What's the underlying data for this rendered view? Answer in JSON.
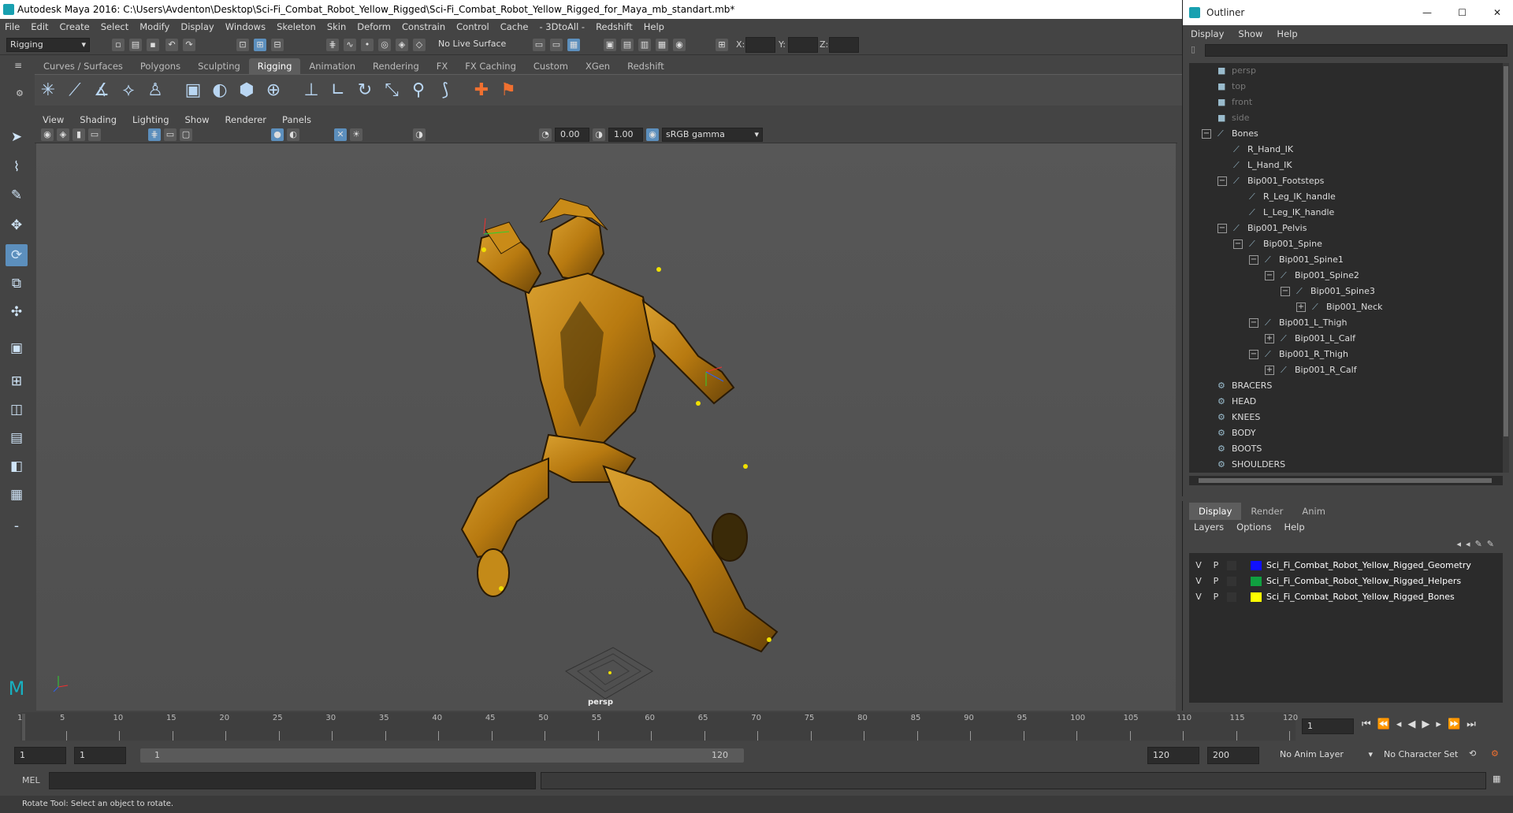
{
  "window": {
    "title": "Autodesk Maya 2016: C:\\Users\\Avdenton\\Desktop\\Sci-Fi_Combat_Robot_Yellow_Rigged\\Sci-Fi_Combat_Robot_Yellow_Rigged_for_Maya_mb_standart.mb*"
  },
  "menus": [
    "File",
    "Edit",
    "Create",
    "Select",
    "Modify",
    "Display",
    "Windows",
    "Skeleton",
    "Skin",
    "Deform",
    "Constrain",
    "Control",
    "Cache",
    "- 3DtoAll -",
    "Redshift",
    "Help"
  ],
  "toolbar": {
    "mode": "Rigging",
    "live_surface": "No Live Surface",
    "x_label": "X:",
    "y_label": "Y:",
    "z_label": "Z:"
  },
  "shelf_tabs": [
    "Curves / Surfaces",
    "Polygons",
    "Sculpting",
    "Rigging",
    "Animation",
    "Rendering",
    "FX",
    "FX Caching",
    "Custom",
    "XGen",
    "Redshift"
  ],
  "active_shelf": "Rigging",
  "viewport": {
    "menus": [
      "View",
      "Shading",
      "Lighting",
      "Show",
      "Renderer",
      "Panels"
    ],
    "near": "0.00",
    "far": "1.00",
    "color_space": "sRGB gamma",
    "camera_label": "persp"
  },
  "timeline": {
    "ticks": [
      "1",
      "5",
      "10",
      "15",
      "20",
      "25",
      "30",
      "35",
      "40",
      "45",
      "50",
      "55",
      "60",
      "65",
      "70",
      "75",
      "80",
      "85",
      "90",
      "95",
      "100",
      "105",
      "110",
      "115",
      "120"
    ],
    "current_frame": "1"
  },
  "range": {
    "start": "1",
    "start_inner": "1",
    "slider_start": "1",
    "slider_end": "120",
    "end_inner": "120",
    "end": "200",
    "anim_layer": "No Anim Layer",
    "character_set": "No Character Set"
  },
  "command": {
    "lang": "MEL"
  },
  "status": {
    "text": "Rotate Tool: Select an object to rotate."
  },
  "outliner": {
    "title": "Outliner",
    "menus": [
      "Display",
      "Show",
      "Help"
    ],
    "items": [
      {
        "label": "persp",
        "icon": "camera-icon",
        "indent": 2,
        "dim": true
      },
      {
        "label": "top",
        "icon": "camera-icon",
        "indent": 2,
        "dim": true
      },
      {
        "label": "front",
        "icon": "camera-icon",
        "indent": 2,
        "dim": true
      },
      {
        "label": "side",
        "icon": "camera-icon",
        "indent": 2,
        "dim": true
      },
      {
        "label": "Bones",
        "icon": "joint-icon",
        "indent": 2,
        "exp": "−"
      },
      {
        "label": "R_Hand_IK",
        "icon": "joint-icon",
        "indent": 3
      },
      {
        "label": "L_Hand_IK",
        "icon": "joint-icon",
        "indent": 3
      },
      {
        "label": "Bip001_Footsteps",
        "icon": "joint-icon",
        "indent": 3,
        "exp": "−"
      },
      {
        "label": "R_Leg_IK_handle",
        "icon": "joint-icon",
        "indent": 4
      },
      {
        "label": "L_Leg_IK_handle",
        "icon": "joint-icon",
        "indent": 4
      },
      {
        "label": "Bip001_Pelvis",
        "icon": "joint-icon",
        "indent": 3,
        "exp": "−"
      },
      {
        "label": "Bip001_Spine",
        "icon": "joint-icon",
        "indent": 4,
        "exp": "−"
      },
      {
        "label": "Bip001_Spine1",
        "icon": "joint-icon",
        "indent": 5,
        "exp": "−"
      },
      {
        "label": "Bip001_Spine2",
        "icon": "joint-icon",
        "indent": 6,
        "exp": "−"
      },
      {
        "label": "Bip001_Spine3",
        "icon": "joint-icon",
        "indent": 7,
        "exp": "−"
      },
      {
        "label": "Bip001_Neck",
        "icon": "joint-icon",
        "indent": 8,
        "exp": "+"
      },
      {
        "label": "Bip001_L_Thigh",
        "icon": "joint-icon",
        "indent": 5,
        "exp": "−"
      },
      {
        "label": "Bip001_L_Calf",
        "icon": "joint-icon",
        "indent": 6,
        "exp": "+"
      },
      {
        "label": "Bip001_R_Thigh",
        "icon": "joint-icon",
        "indent": 5,
        "exp": "−"
      },
      {
        "label": "Bip001_R_Calf",
        "icon": "joint-icon",
        "indent": 6,
        "exp": "+"
      },
      {
        "label": "BRACERS",
        "icon": "group-icon",
        "indent": 2
      },
      {
        "label": "HEAD",
        "icon": "group-icon",
        "indent": 2
      },
      {
        "label": "KNEES",
        "icon": "group-icon",
        "indent": 2
      },
      {
        "label": "BODY",
        "icon": "group-icon",
        "indent": 2
      },
      {
        "label": "BOOTS",
        "icon": "group-icon",
        "indent": 2
      },
      {
        "label": "SHOULDERS",
        "icon": "group-icon",
        "indent": 2
      }
    ]
  },
  "layers": {
    "tabs": [
      "Display",
      "Render",
      "Anim"
    ],
    "active_tab": "Display",
    "menus": [
      "Layers",
      "Options",
      "Help"
    ],
    "rows": [
      {
        "v": "V",
        "p": "P",
        "color": "#1010ff",
        "name": "Sci_Fi_Combat_Robot_Yellow_Rigged_Geometry"
      },
      {
        "v": "V",
        "p": "P",
        "color": "#10a040",
        "name": "Sci_Fi_Combat_Robot_Yellow_Rigged_Helpers"
      },
      {
        "v": "V",
        "p": "P",
        "color": "#ffff00",
        "name": "Sci_Fi_Combat_Robot_Yellow_Rigged_Bones"
      }
    ]
  }
}
